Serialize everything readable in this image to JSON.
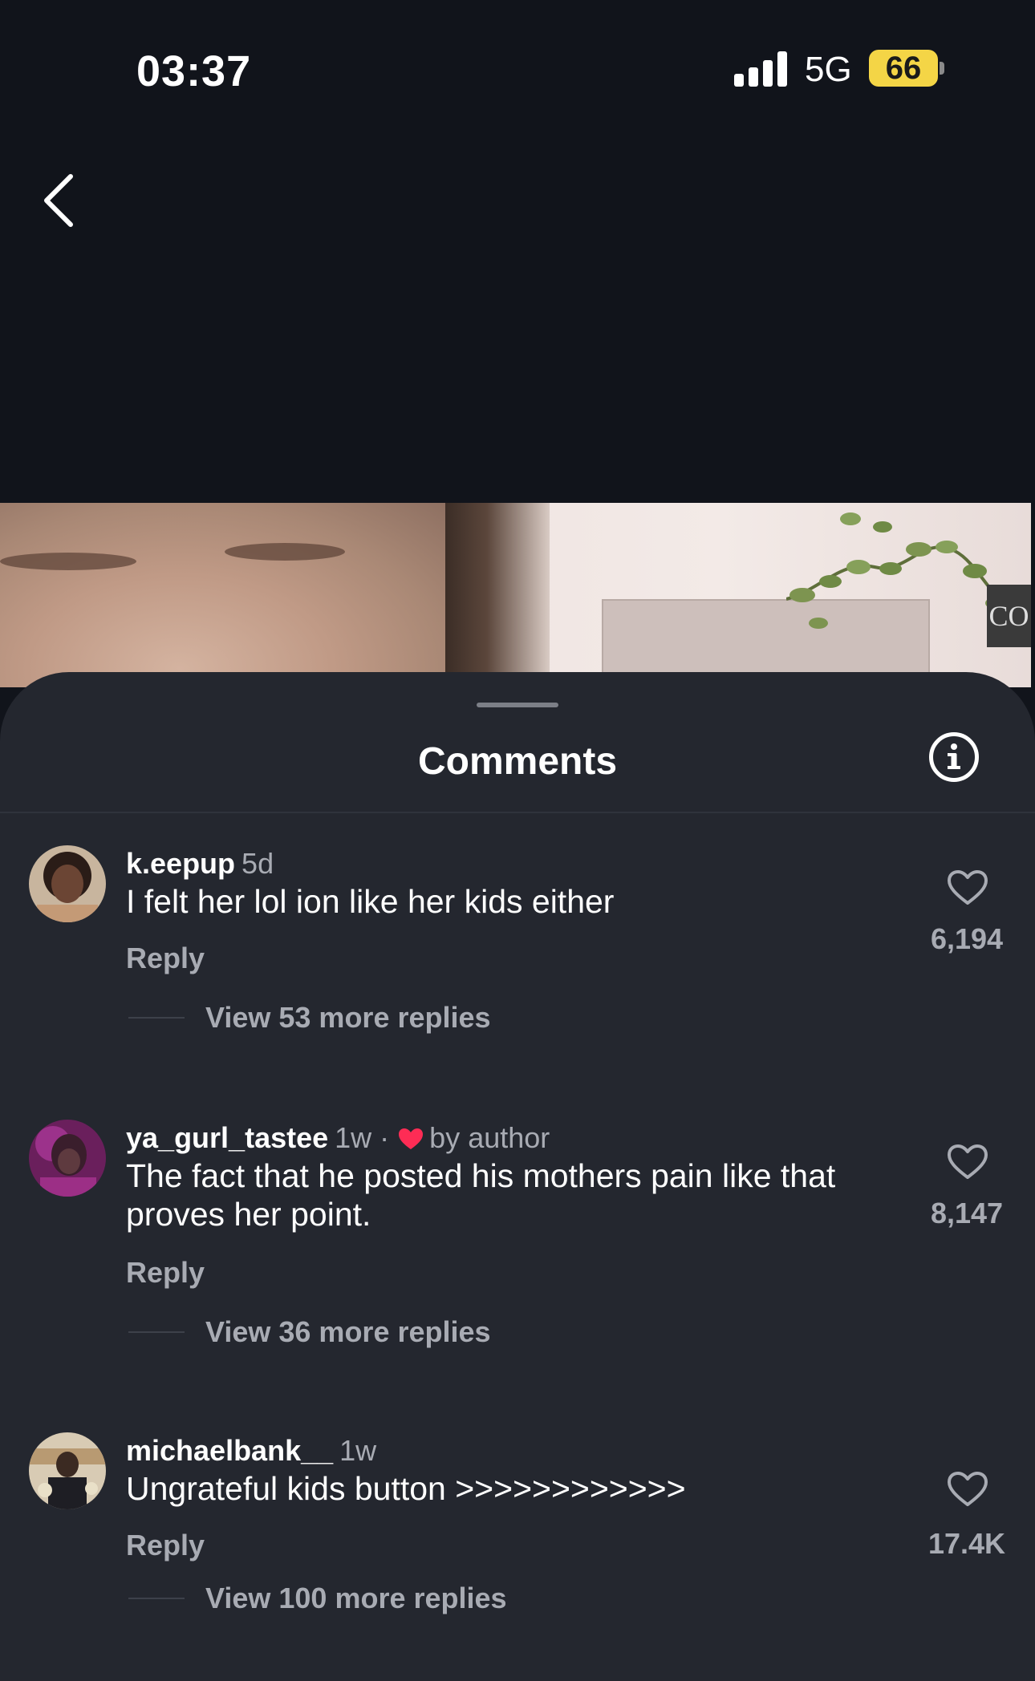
{
  "status_bar": {
    "time": "03:37",
    "network": "5G",
    "battery": "66"
  },
  "icons": {
    "back": "chevron-left-icon",
    "info": "info-icon",
    "like": "heart-outline-icon",
    "author_heart": "heart-filled-icon"
  },
  "video": {
    "sign_text": "CO"
  },
  "comments_sheet": {
    "title": "Comments",
    "comments": [
      {
        "username": "k.eepup",
        "time": "5d",
        "text": "I felt her lol ion like her kids either",
        "reply_label": "Reply",
        "likes": "6,194",
        "view_replies": "View 53 more replies"
      },
      {
        "username": "ya_gurl_tastee",
        "time": "1w",
        "badge": "by author",
        "text": "The fact that he posted his mothers pain like that proves her point.",
        "reply_label": "Reply",
        "likes": "8,147",
        "view_replies": "View 36 more replies"
      },
      {
        "username": "michaelbank__",
        "time": "1w",
        "text": "Ungrateful kids button >>>>>>>>>>>>",
        "reply_label": "Reply",
        "likes": "17.4K",
        "view_replies": "View 100 more replies"
      }
    ]
  },
  "colors": {
    "background": "#11141b",
    "sheet": "#24272f",
    "secondary_text": "#a8abb3",
    "author_heart": "#fe2c55",
    "battery": "#f4d546"
  }
}
